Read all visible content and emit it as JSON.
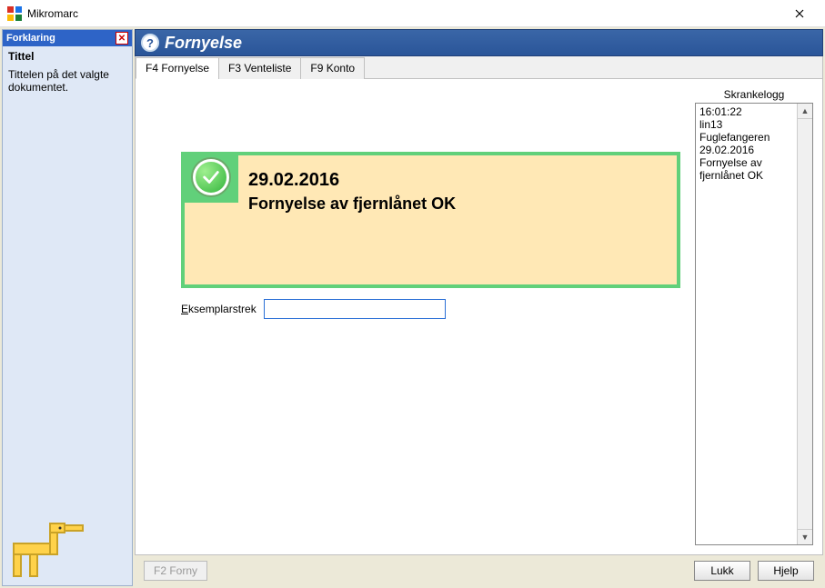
{
  "window": {
    "title": "Mikromarc"
  },
  "sidebar": {
    "head": "Forklaring",
    "title": "Tittel",
    "desc": "Tittelen på det valgte dokumentet."
  },
  "header": {
    "title": "Fornyelse"
  },
  "tabs": [
    {
      "label": "F4 Fornyelse",
      "active": true
    },
    {
      "label": "F3 Venteliste",
      "active": false
    },
    {
      "label": "F9 Konto",
      "active": false
    }
  ],
  "message": {
    "date": "29.02.2016",
    "text": "Fornyelse av fjernlånet OK"
  },
  "field": {
    "label_pre": "E",
    "label_rest": "ksemplarstrek",
    "value": ""
  },
  "log": {
    "label": "Skrankelogg",
    "entries": [
      "16:01:22",
      "lin13",
      "Fuglefangeren",
      "",
      "29.02.2016",
      "Fornyelse av fjernlånet OK"
    ]
  },
  "footer": {
    "renew": "F2 Forny",
    "close": "Lukk",
    "help": "Hjelp"
  }
}
